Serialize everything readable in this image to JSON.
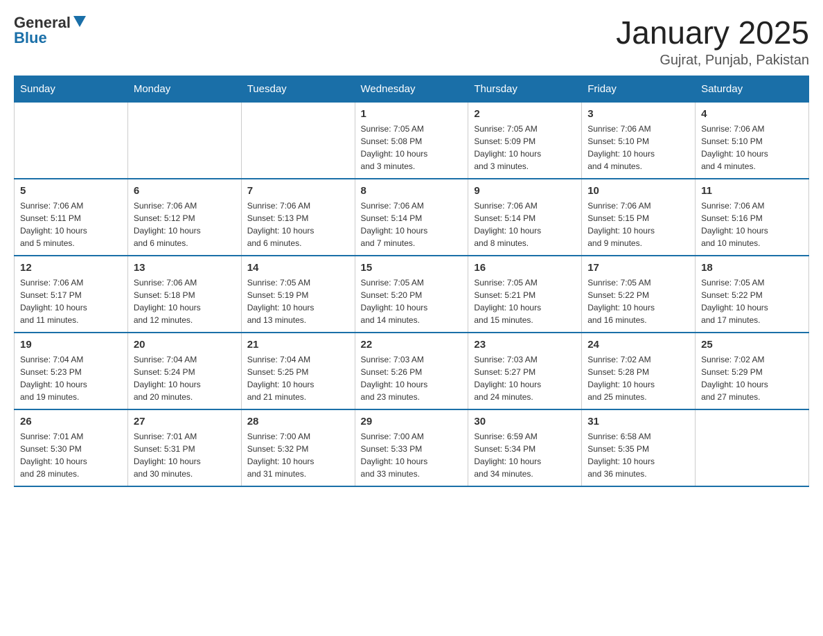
{
  "header": {
    "logo": {
      "general": "General",
      "blue": "Blue"
    },
    "title": "January 2025",
    "subtitle": "Gujrat, Punjab, Pakistan"
  },
  "days_of_week": [
    "Sunday",
    "Monday",
    "Tuesday",
    "Wednesday",
    "Thursday",
    "Friday",
    "Saturday"
  ],
  "weeks": [
    [
      {
        "day": "",
        "info": ""
      },
      {
        "day": "",
        "info": ""
      },
      {
        "day": "",
        "info": ""
      },
      {
        "day": "1",
        "info": "Sunrise: 7:05 AM\nSunset: 5:08 PM\nDaylight: 10 hours\nand 3 minutes."
      },
      {
        "day": "2",
        "info": "Sunrise: 7:05 AM\nSunset: 5:09 PM\nDaylight: 10 hours\nand 3 minutes."
      },
      {
        "day": "3",
        "info": "Sunrise: 7:06 AM\nSunset: 5:10 PM\nDaylight: 10 hours\nand 4 minutes."
      },
      {
        "day": "4",
        "info": "Sunrise: 7:06 AM\nSunset: 5:10 PM\nDaylight: 10 hours\nand 4 minutes."
      }
    ],
    [
      {
        "day": "5",
        "info": "Sunrise: 7:06 AM\nSunset: 5:11 PM\nDaylight: 10 hours\nand 5 minutes."
      },
      {
        "day": "6",
        "info": "Sunrise: 7:06 AM\nSunset: 5:12 PM\nDaylight: 10 hours\nand 6 minutes."
      },
      {
        "day": "7",
        "info": "Sunrise: 7:06 AM\nSunset: 5:13 PM\nDaylight: 10 hours\nand 6 minutes."
      },
      {
        "day": "8",
        "info": "Sunrise: 7:06 AM\nSunset: 5:14 PM\nDaylight: 10 hours\nand 7 minutes."
      },
      {
        "day": "9",
        "info": "Sunrise: 7:06 AM\nSunset: 5:14 PM\nDaylight: 10 hours\nand 8 minutes."
      },
      {
        "day": "10",
        "info": "Sunrise: 7:06 AM\nSunset: 5:15 PM\nDaylight: 10 hours\nand 9 minutes."
      },
      {
        "day": "11",
        "info": "Sunrise: 7:06 AM\nSunset: 5:16 PM\nDaylight: 10 hours\nand 10 minutes."
      }
    ],
    [
      {
        "day": "12",
        "info": "Sunrise: 7:06 AM\nSunset: 5:17 PM\nDaylight: 10 hours\nand 11 minutes."
      },
      {
        "day": "13",
        "info": "Sunrise: 7:06 AM\nSunset: 5:18 PM\nDaylight: 10 hours\nand 12 minutes."
      },
      {
        "day": "14",
        "info": "Sunrise: 7:05 AM\nSunset: 5:19 PM\nDaylight: 10 hours\nand 13 minutes."
      },
      {
        "day": "15",
        "info": "Sunrise: 7:05 AM\nSunset: 5:20 PM\nDaylight: 10 hours\nand 14 minutes."
      },
      {
        "day": "16",
        "info": "Sunrise: 7:05 AM\nSunset: 5:21 PM\nDaylight: 10 hours\nand 15 minutes."
      },
      {
        "day": "17",
        "info": "Sunrise: 7:05 AM\nSunset: 5:22 PM\nDaylight: 10 hours\nand 16 minutes."
      },
      {
        "day": "18",
        "info": "Sunrise: 7:05 AM\nSunset: 5:22 PM\nDaylight: 10 hours\nand 17 minutes."
      }
    ],
    [
      {
        "day": "19",
        "info": "Sunrise: 7:04 AM\nSunset: 5:23 PM\nDaylight: 10 hours\nand 19 minutes."
      },
      {
        "day": "20",
        "info": "Sunrise: 7:04 AM\nSunset: 5:24 PM\nDaylight: 10 hours\nand 20 minutes."
      },
      {
        "day": "21",
        "info": "Sunrise: 7:04 AM\nSunset: 5:25 PM\nDaylight: 10 hours\nand 21 minutes."
      },
      {
        "day": "22",
        "info": "Sunrise: 7:03 AM\nSunset: 5:26 PM\nDaylight: 10 hours\nand 23 minutes."
      },
      {
        "day": "23",
        "info": "Sunrise: 7:03 AM\nSunset: 5:27 PM\nDaylight: 10 hours\nand 24 minutes."
      },
      {
        "day": "24",
        "info": "Sunrise: 7:02 AM\nSunset: 5:28 PM\nDaylight: 10 hours\nand 25 minutes."
      },
      {
        "day": "25",
        "info": "Sunrise: 7:02 AM\nSunset: 5:29 PM\nDaylight: 10 hours\nand 27 minutes."
      }
    ],
    [
      {
        "day": "26",
        "info": "Sunrise: 7:01 AM\nSunset: 5:30 PM\nDaylight: 10 hours\nand 28 minutes."
      },
      {
        "day": "27",
        "info": "Sunrise: 7:01 AM\nSunset: 5:31 PM\nDaylight: 10 hours\nand 30 minutes."
      },
      {
        "day": "28",
        "info": "Sunrise: 7:00 AM\nSunset: 5:32 PM\nDaylight: 10 hours\nand 31 minutes."
      },
      {
        "day": "29",
        "info": "Sunrise: 7:00 AM\nSunset: 5:33 PM\nDaylight: 10 hours\nand 33 minutes."
      },
      {
        "day": "30",
        "info": "Sunrise: 6:59 AM\nSunset: 5:34 PM\nDaylight: 10 hours\nand 34 minutes."
      },
      {
        "day": "31",
        "info": "Sunrise: 6:58 AM\nSunset: 5:35 PM\nDaylight: 10 hours\nand 36 minutes."
      },
      {
        "day": "",
        "info": ""
      }
    ]
  ]
}
